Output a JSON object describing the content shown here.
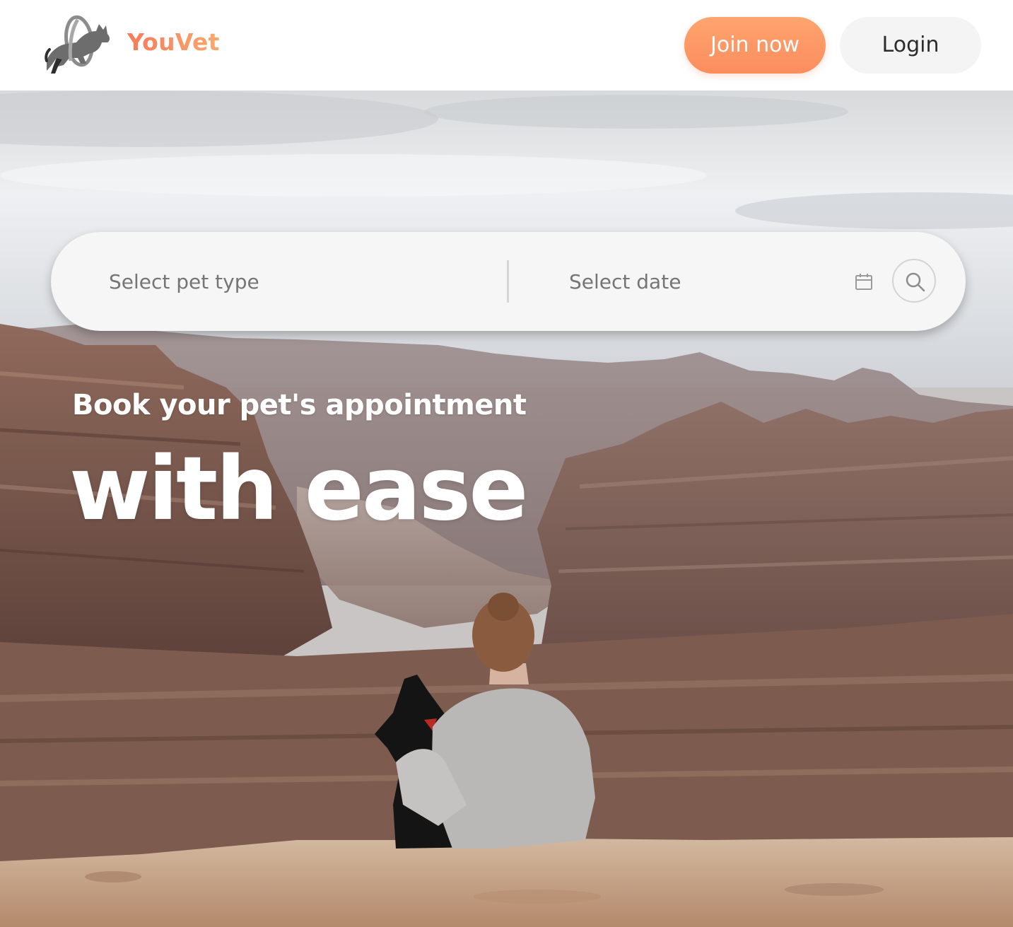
{
  "header": {
    "brand": "YouVet",
    "join_label": "Join now",
    "login_label": "Login"
  },
  "search": {
    "pet_type_placeholder": "Select pet type",
    "date_placeholder": "Select date",
    "calendar_icon": "calendar-icon",
    "search_icon": "search-icon"
  },
  "hero": {
    "subtitle": "Book your pet's appointment",
    "title": "with ease",
    "background": "photo-canyon-woman-with-dog"
  },
  "colors": {
    "brand_gradient_start": "#f77a5a",
    "brand_gradient_end": "#f9a96e",
    "join_button": "#fb955f",
    "login_button": "#f4f4f4",
    "search_bar": "#f6f6f6",
    "headline": "#ffffff"
  }
}
